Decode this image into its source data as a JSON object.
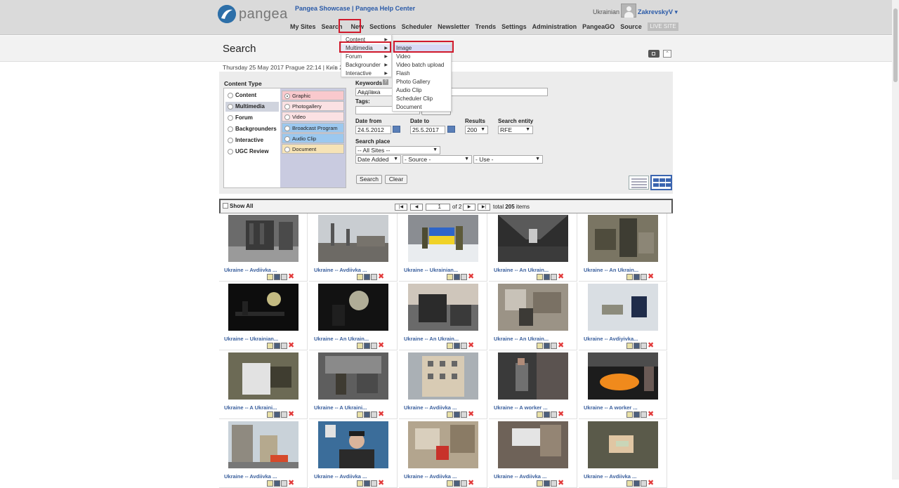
{
  "header": {
    "logo_text": "pangea",
    "links": [
      "Pangea Showcase",
      "Pangea Help Center"
    ],
    "link_separator": " | ",
    "language": "Ukrainian",
    "username": "ZakrevskyV ▾",
    "live_site": "LIVE SITE"
  },
  "nav": {
    "items": [
      "My Sites",
      "Search",
      "New",
      "Sections",
      "Scheduler",
      "Newsletter",
      "Trends",
      "Settings",
      "Administration",
      "PangeaGO",
      "Source"
    ],
    "active": "New"
  },
  "menu_new": {
    "items": [
      "Content",
      "Multimedia",
      "Forum",
      "Backgrounder",
      "Interactive"
    ],
    "active": "Multimedia"
  },
  "menu_multimedia": {
    "items": [
      "Image",
      "Video",
      "Video batch upload",
      "Flash",
      "Photo Gallery",
      "Audio Clip",
      "Scheduler Clip",
      "Document"
    ],
    "active": "Image"
  },
  "page": {
    "title": "Search",
    "dateline": "Thursday 25 May 2017 Prague 22:14 | Київ 23"
  },
  "filters": {
    "content_type_label": "Content Type",
    "types": [
      "Content",
      "Multimedia",
      "Forum",
      "Backgrounders",
      "Interactive",
      "UGC Review"
    ],
    "selected_type": "Multimedia",
    "subtypes": [
      "Graphic",
      "Photogallery",
      "Video",
      "Broadcast Program",
      "Audio Clip",
      "Document"
    ],
    "selected_subtype": "Graphic",
    "keywords_label": "Keywords",
    "keywords_value": "Авдіївка",
    "tags_label": "Tags:",
    "date_from_label": "Date from",
    "date_from": "24.5.2012",
    "date_to_label": "Date to",
    "date_to": "25.5.2017",
    "results_label": "Results",
    "results_value": "200",
    "search_entity_label": "Search entity",
    "search_entity_value": "RFE",
    "search_place_label": "Search place",
    "sites_value": "-- All Sites --",
    "date_added_value": "Date Added",
    "source_value": "- Source -",
    "use_value": "- Use -",
    "search_button": "Search",
    "clear_button": "Clear"
  },
  "pagination": {
    "show_all": "Show All",
    "current_page": "1",
    "of_text": "of 2",
    "total_prefix": "total ",
    "total_count": "205",
    "total_suffix": " items"
  },
  "results": [
    {
      "caption": "Ukraine -- Avdiivka ...",
      "scene": "building"
    },
    {
      "caption": "Ukraine -- Avdiivka ...",
      "scene": "factory"
    },
    {
      "caption": "Ukraine -- Ukrainian...",
      "scene": "flag"
    },
    {
      "caption": "Ukraine -- An Ukrain...",
      "scene": "hall"
    },
    {
      "caption": "Ukraine -- An Ukrain...",
      "scene": "soldier"
    },
    {
      "caption": "Ukraine -- Ukrainian...",
      "scene": "night"
    },
    {
      "caption": "Ukraine -- An Ukrain...",
      "scene": "sparks"
    },
    {
      "caption": "Ukraine -- An Ukrain...",
      "scene": "ruins-dusk"
    },
    {
      "caption": "Ukraine -- An Ukrain...",
      "scene": "rubble"
    },
    {
      "caption": "Ukraine -- Avdiyivka...",
      "scene": "snow"
    },
    {
      "caption": "Ukraine -- A Ukraini...",
      "scene": "camo"
    },
    {
      "caption": "Ukraine -- A Ukraini...",
      "scene": "wreck"
    },
    {
      "caption": "Ukraine -- Avdiivka ...",
      "scene": "apartment"
    },
    {
      "caption": "Ukraine -- A worker ...",
      "scene": "worker"
    },
    {
      "caption": "Ukraine -- A worker ...",
      "scene": "furnace"
    },
    {
      "caption": "Ukraine -- Avdiivka ...",
      "scene": "street"
    },
    {
      "caption": "Ukraine -- Avdiivka ...",
      "scene": "portrait"
    },
    {
      "caption": "Ukraine -- Avdiivka ...",
      "scene": "debris"
    },
    {
      "caption": "Ukraine -- Avdiivka ...",
      "scene": "roof"
    },
    {
      "caption": "Ukraine -- Avdiivka ...",
      "scene": "hands"
    }
  ],
  "icons": {
    "add": "image-add-icon",
    "save": "save-icon",
    "preview": "preview-icon",
    "delete": "delete-icon"
  },
  "colors": {
    "link": "#3a5f9d",
    "highlight": "#d0192b",
    "accent": "#3b65b0"
  }
}
